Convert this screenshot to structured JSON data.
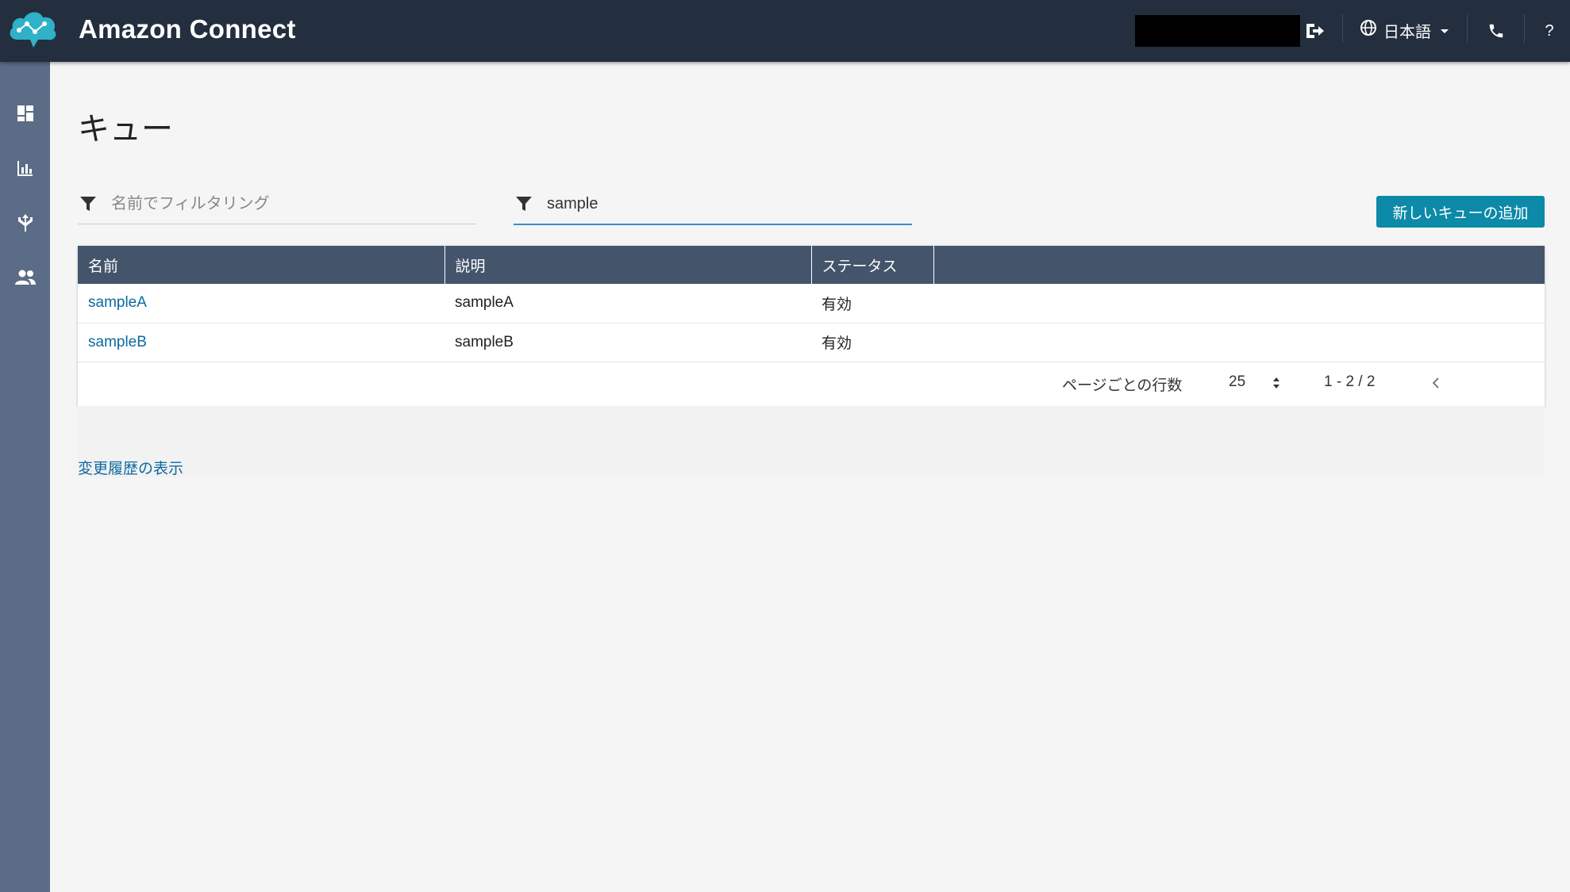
{
  "header": {
    "app_title": "Amazon Connect",
    "language": "日本語",
    "help": "?"
  },
  "sidebar": {
    "items": [
      {
        "name": "dashboard",
        "icon": "dashboard-icon"
      },
      {
        "name": "metrics",
        "icon": "bar-chart-icon"
      },
      {
        "name": "routing",
        "icon": "routing-icon"
      },
      {
        "name": "users",
        "icon": "users-icon"
      }
    ]
  },
  "page": {
    "title": "キュー"
  },
  "filters": {
    "name_placeholder": "名前でフィルタリング",
    "second_value": "sample"
  },
  "actions": {
    "add_queue": "新しいキューの追加"
  },
  "table": {
    "columns": [
      "名前",
      "説明",
      "ステータス",
      ""
    ],
    "rows": [
      {
        "name": "sampleA",
        "description": "sampleA",
        "status": "有効"
      },
      {
        "name": "sampleB",
        "description": "sampleB",
        "status": "有効"
      }
    ]
  },
  "pagination": {
    "rows_per_page_label": "ページごとの行数",
    "rows_per_page": "25",
    "range": "1 - 2 / 2"
  },
  "links": {
    "change_history": "変更履歴の表示"
  },
  "colors": {
    "topbar": "#232f3e",
    "sidebar": "#5b6c86",
    "table_header": "#44546b",
    "primary_button": "#0c8aa8",
    "link": "#0b6aa0"
  }
}
